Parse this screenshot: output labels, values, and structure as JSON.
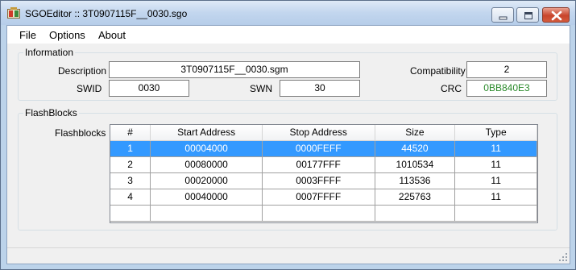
{
  "window": {
    "title": "SGOEditor :: 3T0907115F__0030.sgo",
    "app_icon": "sgoeditor-app-icon",
    "controls": [
      "minimize-icon",
      "maximize-icon",
      "close-icon"
    ]
  },
  "menu": {
    "items": [
      {
        "label": "File"
      },
      {
        "label": "Options"
      },
      {
        "label": "About"
      }
    ]
  },
  "information": {
    "legend": "Information",
    "description_label": "Description",
    "description_value": "3T0907115F__0030.sgm",
    "compatibility_label": "Compatibility",
    "compatibility_value": "2",
    "swid_label": "SWID",
    "swid_value": "0030",
    "swn_label": "SWN",
    "swn_value": "30",
    "crc_label": "CRC",
    "crc_value": "0BB840E3",
    "crc_color": "#2a8a2a"
  },
  "flashblocks": {
    "legend": "FlashBlocks",
    "label": "Flashblocks",
    "columns": [
      "#",
      "Start Address",
      "Stop Address",
      "Size",
      "Type"
    ],
    "rows": [
      [
        "1",
        "00004000",
        "0000FEFF",
        "44520",
        "11"
      ],
      [
        "2",
        "00080000",
        "00177FFF",
        "1010534",
        "11"
      ],
      [
        "3",
        "00020000",
        "0003FFFF",
        "113536",
        "11"
      ],
      [
        "4",
        "00040000",
        "0007FFFF",
        "225763",
        "11"
      ]
    ],
    "selected_row": 1,
    "selection_color": "#3399ff"
  }
}
